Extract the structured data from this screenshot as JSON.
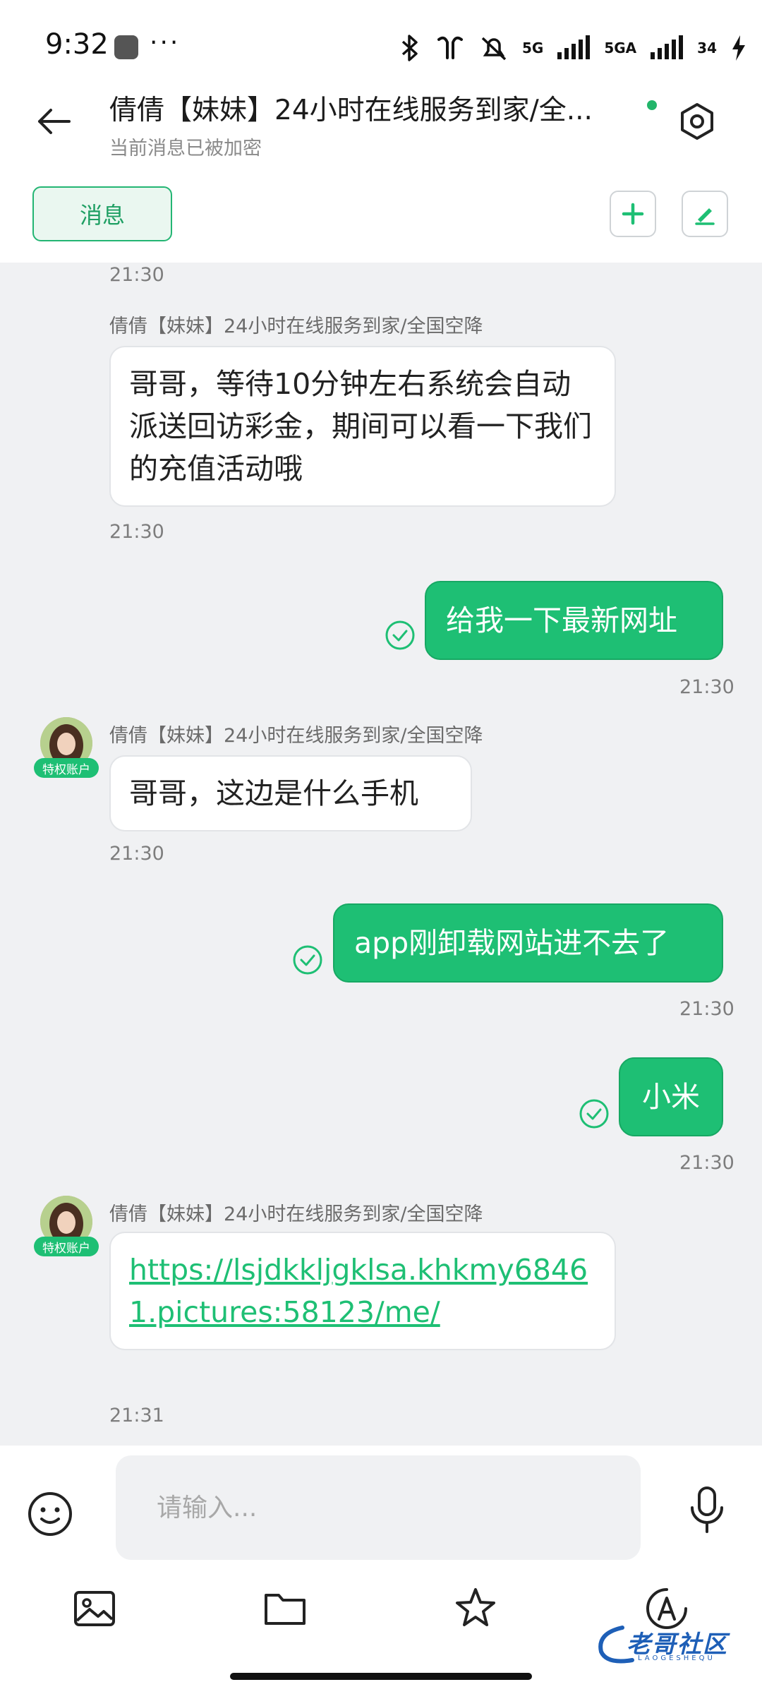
{
  "status_bar": {
    "time": "9:32",
    "dots": "···",
    "net1": "5G",
    "net2": "5GA",
    "battery": "34"
  },
  "header": {
    "title": "倩倩【妹妹】24小时在线服务到家/全...",
    "subtitle": "当前消息已被加密"
  },
  "toolbar": {
    "tab_label": "消息"
  },
  "messages": {
    "m0_time": "21:30",
    "m1_sender": "倩倩【妹妹】24小时在线服务到家/全国空降",
    "m1_text": "哥哥，等待10分钟左右系统会自动派送回访彩金，期间可以看一下我们的充值活动哦",
    "m1_time": "21:30",
    "m2_text": "给我一下最新网址",
    "m2_time": "21:30",
    "m3_sender": "倩倩【妹妹】24小时在线服务到家/全国空降",
    "m3_badge": "特权账户",
    "m3_text": "哥哥，这边是什么手机",
    "m3_time": "21:30",
    "m4_text": "app刚卸载网站进不去了",
    "m4_time": "21:30",
    "m5_text": "小米",
    "m5_time": "21:30",
    "m6_sender": "倩倩【妹妹】24小时在线服务到家/全国空降",
    "m6_badge": "特权账户",
    "m6_link": "https://lsjdkkljgklsa.khkmy68461.pictures:58123/me/",
    "m6_time": "21:31"
  },
  "input": {
    "placeholder": "请输入..."
  },
  "watermark": {
    "text": "老哥社区",
    "sub": "LAOGESHEQU"
  },
  "colors": {
    "accent": "#1ebf74",
    "chat_bg": "#f0f1f3"
  }
}
